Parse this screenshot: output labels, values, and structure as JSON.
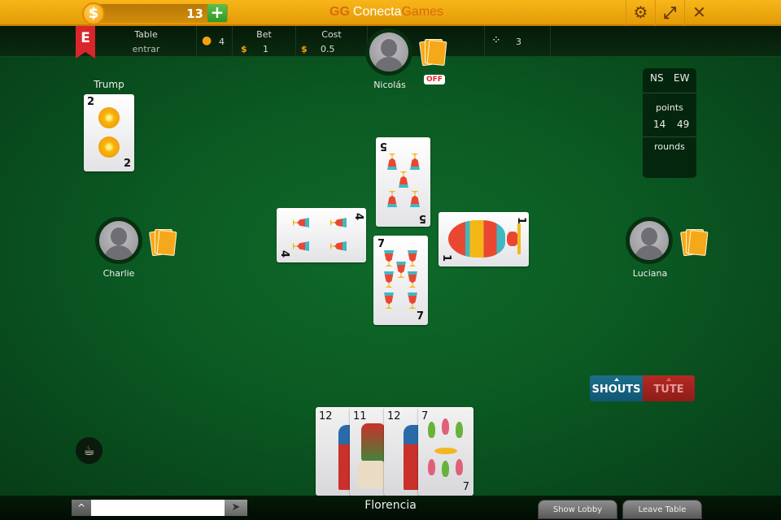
{
  "topbar": {
    "coin_icon": "$",
    "coins": "13",
    "add_coins_icon": "+",
    "logo_mark": "GG",
    "logo_part1": "Conecta",
    "logo_part2": "Games",
    "settings_icon": "⚙",
    "fullscreen_icon": "⤢",
    "close_icon": "✕"
  },
  "infobar": {
    "game_badge": "E",
    "table_label": "Table",
    "table_value": "entrar",
    "players_count": "4",
    "bet_label": "Bet",
    "bet_currency": "$",
    "bet_value": "1",
    "cost_label": "Cost",
    "cost_currency": "$",
    "cost_value": "0.5",
    "dice_icon": "⁘",
    "rounds_value": "3"
  },
  "players": {
    "north": {
      "name": "Nicolás",
      "shout_badge": "OFF"
    },
    "west": {
      "name": "Charlie"
    },
    "east": {
      "name": "Luciana"
    },
    "south": {
      "name": "Florencia"
    }
  },
  "trump": {
    "label": "Trump",
    "rank": "2",
    "suit": "oros"
  },
  "table_cards": [
    {
      "position": "north",
      "rank": "5",
      "suit": "copas"
    },
    {
      "position": "west",
      "rank": "4",
      "suit": "copas"
    },
    {
      "position": "east",
      "rank": "1",
      "suit": "copas"
    },
    {
      "position": "south",
      "rank": "7",
      "suit": "copas"
    }
  ],
  "hand": [
    {
      "rank": "12",
      "suit": "oros"
    },
    {
      "rank": "11",
      "suit": "espadas"
    },
    {
      "rank": "12",
      "suit": "espadas"
    },
    {
      "rank": "7",
      "suit": "bastos"
    }
  ],
  "score": {
    "team1": "NS",
    "team2": "EW",
    "points_label": "points",
    "points_ns": "14",
    "points_ew": "49",
    "rounds_label": "rounds"
  },
  "actions": {
    "shouts": "SHOUTS",
    "tute": "TUTE"
  },
  "bottom": {
    "chat_toggle_icon": "^",
    "chat_placeholder": "",
    "send_icon": "➤",
    "show_lobby": "Show Lobby",
    "leave_table": "Leave Table",
    "coffee_icon": "☕"
  }
}
